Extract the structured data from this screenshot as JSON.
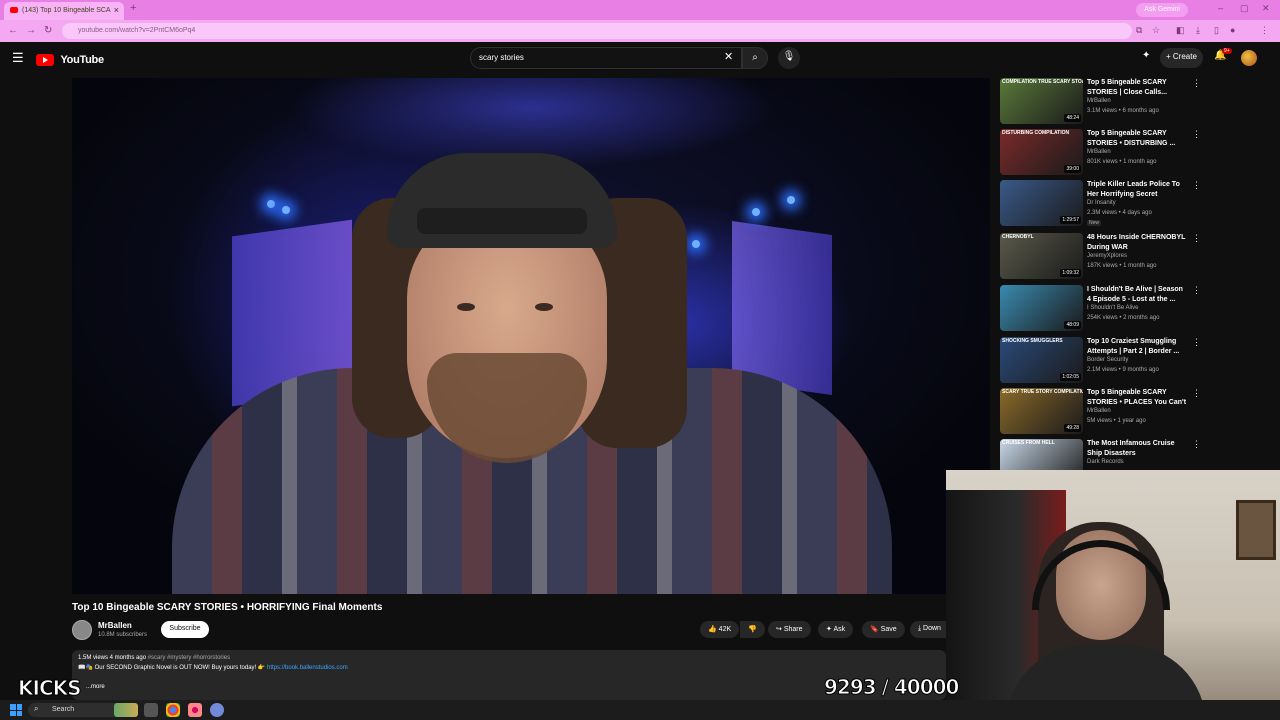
{
  "browser": {
    "tab_title": "(143) Top 10 Bingeable SCA",
    "url": "youtube.com/watch?v=2PntCM6oPq4",
    "gemini_label": "Ask Gemini"
  },
  "youtube": {
    "logo_text": "YouTube",
    "search_query": "scary stories",
    "create_label": "Create",
    "notif_badge": "9+"
  },
  "video": {
    "title": "Top 10 Bingeable SCARY STORIES • HORRIFYING Final Moments",
    "channel": "MrBallen",
    "subscribers": "10.8M subscribers",
    "subscribe_label": "Subscribe",
    "likes": "42K",
    "share_label": "Share",
    "ask_label": "Ask",
    "save_label": "Save",
    "download_label": "Down",
    "desc_meta": "1.5M views  4 months ago",
    "desc_tags": "#scary #mystery #horrorstories",
    "desc_line": "📖🎭 Our SECOND Graphic Novel is OUT NOW! Buy yours today! 👉",
    "desc_link": "https://book.ballenstudios.com",
    "more_label": "...more"
  },
  "recommendations": [
    {
      "title": "Top 5 Bingeable SCARY STORIES | Close Calls...",
      "channel": "MrBallen",
      "meta": "3.1M views • 6 months ago",
      "duration": "48:24",
      "thumb_label": "COMPILATION TRUE SCARY STORIES",
      "color": "#5a7a3a"
    },
    {
      "title": "Top 5 Bingeable SCARY STORIES • DISTURBING ...",
      "channel": "MrBallen",
      "meta": "801K views • 1 month ago",
      "duration": "39:00",
      "thumb_label": "DISTURBING COMPILATION",
      "color": "#7a2a2a"
    },
    {
      "title": "Triple Killer Leads Police To Her Horrifying Secret",
      "channel": "Dr Insanity",
      "meta": "2.3M views • 4 days ago",
      "duration": "1:29:57",
      "badge": "New",
      "thumb_label": "",
      "color": "#3a5a8a"
    },
    {
      "title": "48 Hours Inside CHERNOBYL During WAR",
      "channel": "JeremyXplores",
      "meta": "187K views • 1 month ago",
      "duration": "1:09:32",
      "thumb_label": "CHERNOBYL",
      "color": "#5a5a4a"
    },
    {
      "title": "I Shouldn't Be Alive | Season 4 Episode 5 - Lost at the ...",
      "channel": "I Shouldn't Be Alive",
      "meta": "254K views • 2 months ago",
      "duration": "48:09",
      "thumb_label": "",
      "color": "#3a8ab0"
    },
    {
      "title": "Top 10 Craziest Smuggling Attempts | Part 2 | Border ...",
      "channel": "Border Security",
      "meta": "2.1M views • 9 months ago",
      "duration": "1:02:05",
      "thumb_label": "SHOCKING SMUGGLERS",
      "color": "#2a4a7a"
    },
    {
      "title": "Top 5 Bingeable SCARY STORIES • PLACES You Can't ...",
      "channel": "MrBallen",
      "meta": "5M views • 1 year ago",
      "duration": "49:28",
      "thumb_label": "SCARY TRUE STORY COMPILATION",
      "color": "#8a6a2a"
    },
    {
      "title": "The Most Infamous Cruise Ship Disasters",
      "channel": "Dark Records",
      "meta": "",
      "duration": "",
      "thumb_label": "CRUISES FROM HELL",
      "color": "#c8d8e8"
    }
  ],
  "overlay": {
    "brand": "KICKS",
    "counter": "9293 / 40000"
  },
  "taskbar": {
    "search_label": "Search"
  }
}
